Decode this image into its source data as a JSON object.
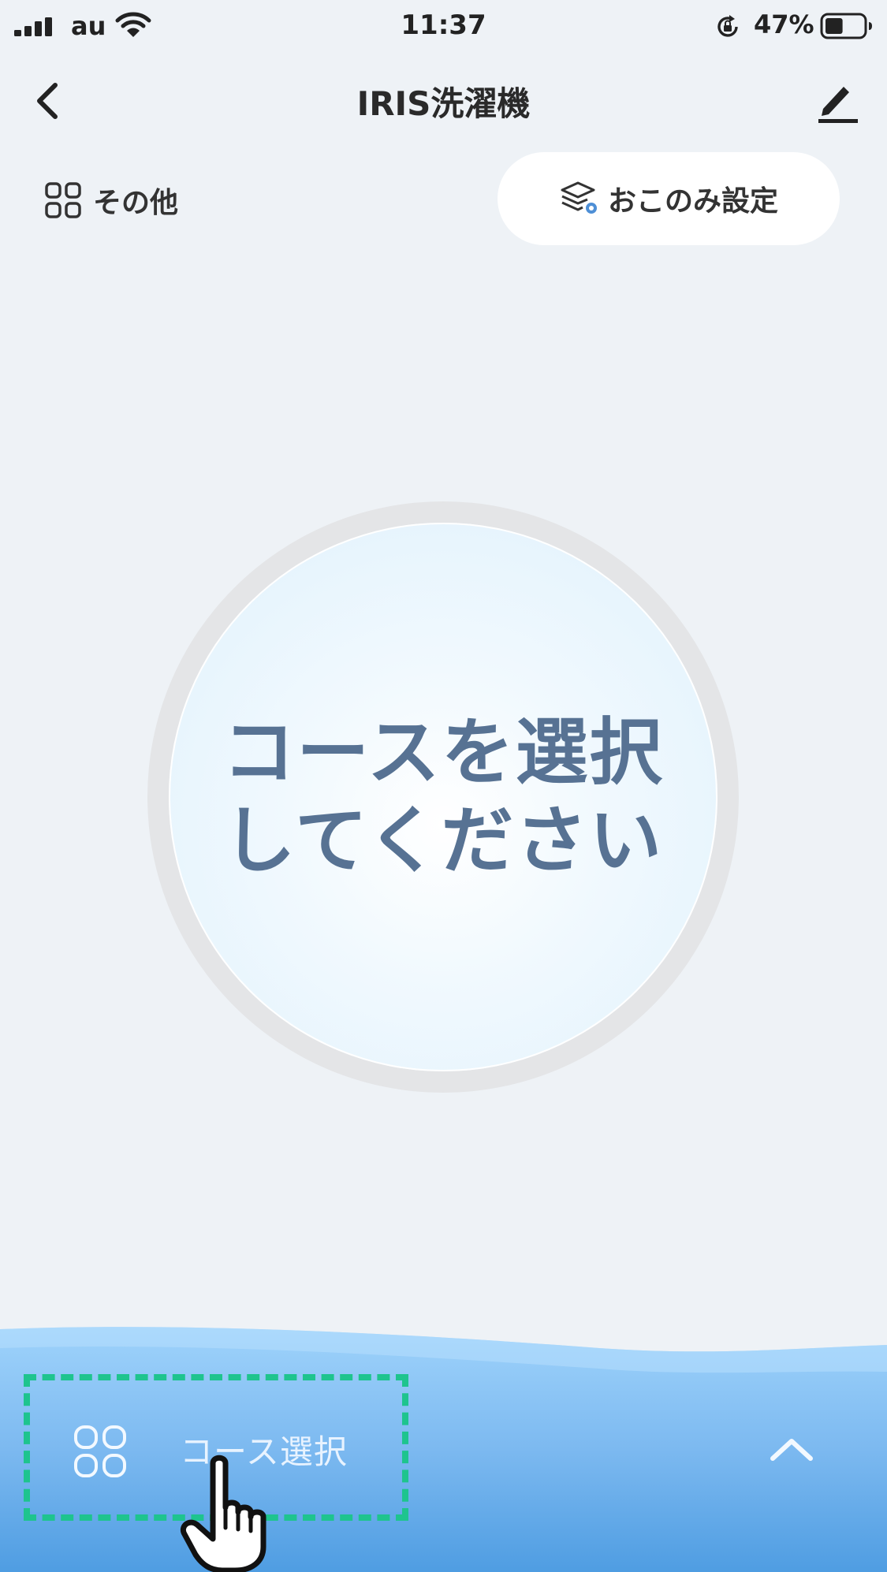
{
  "status_bar": {
    "carrier": "au",
    "time": "11:37",
    "battery_percent": "47%",
    "battery_level": 0.47,
    "icons": [
      "signal-icon",
      "wifi-icon",
      "rotation-lock-icon",
      "battery-icon"
    ]
  },
  "nav": {
    "title": "IRIS洗濯機",
    "back_icon": "chevron-left-icon",
    "edit_icon": "pencil-icon"
  },
  "options": {
    "other_label": "その他",
    "other_icon": "grid-icon",
    "preset_label": "おこのみ設定",
    "preset_icon": "layers-icon"
  },
  "dial": {
    "line1": "コースを選択",
    "line2": "してください"
  },
  "bottom_panel": {
    "course_label": "コース選択",
    "course_icon": "grid-icon",
    "expand_icon": "chevron-up-icon",
    "highlight_color": "#1ec48e",
    "gradient_top": "#9fd3fb",
    "gradient_bottom": "#4f9de2"
  },
  "colors": {
    "background": "#eef2f6",
    "dial_text": "#577293"
  }
}
